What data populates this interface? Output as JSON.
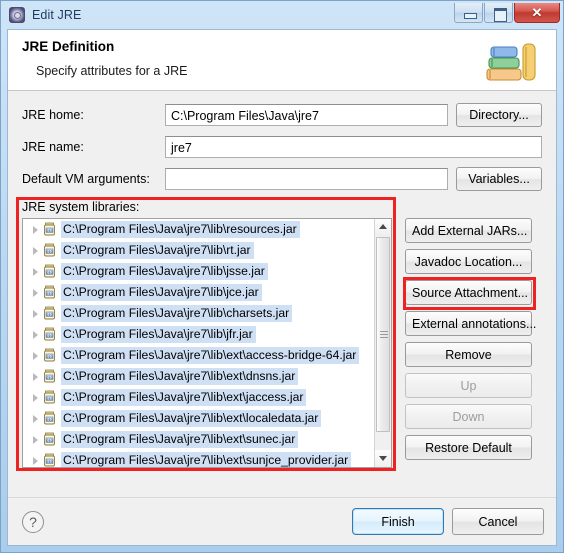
{
  "window": {
    "title": "Edit JRE",
    "icon": "jre-gear-icon",
    "minimize_label": "Minimize",
    "maximize_label": "Maximize",
    "close_label": "✕"
  },
  "header": {
    "title": "JRE Definition",
    "subtitle": "Specify attributes for a JRE",
    "icon": "books-icon"
  },
  "form": {
    "jre_home": {
      "label": "JRE home:",
      "value": "C:\\Program Files\\Java\\jre7",
      "button": "Directory..."
    },
    "jre_name": {
      "label": "JRE name:",
      "value": "jre7"
    },
    "vm_args": {
      "label": "Default VM arguments:",
      "value": "",
      "button": "Variables..."
    }
  },
  "libraries": {
    "label": "JRE system libraries:",
    "items": [
      "C:\\Program Files\\Java\\jre7\\lib\\resources.jar",
      "C:\\Program Files\\Java\\jre7\\lib\\rt.jar",
      "C:\\Program Files\\Java\\jre7\\lib\\jsse.jar",
      "C:\\Program Files\\Java\\jre7\\lib\\jce.jar",
      "C:\\Program Files\\Java\\jre7\\lib\\charsets.jar",
      "C:\\Program Files\\Java\\jre7\\lib\\jfr.jar",
      "C:\\Program Files\\Java\\jre7\\lib\\ext\\access-bridge-64.jar",
      "C:\\Program Files\\Java\\jre7\\lib\\ext\\dnsns.jar",
      "C:\\Program Files\\Java\\jre7\\lib\\ext\\jaccess.jar",
      "C:\\Program Files\\Java\\jre7\\lib\\ext\\localedata.jar",
      "C:\\Program Files\\Java\\jre7\\lib\\ext\\sunec.jar",
      "C:\\Program Files\\Java\\jre7\\lib\\ext\\sunjce_provider.jar"
    ],
    "buttons": [
      {
        "label": "Add External JARs...",
        "enabled": true
      },
      {
        "label": "Javadoc Location...",
        "enabled": true
      },
      {
        "label": "Source Attachment...",
        "enabled": true
      },
      {
        "label": "External annotations...",
        "enabled": true
      },
      {
        "label": "Remove",
        "enabled": true
      },
      {
        "label": "Up",
        "enabled": false
      },
      {
        "label": "Down",
        "enabled": false
      },
      {
        "label": "Restore Default",
        "enabled": true
      }
    ]
  },
  "footer": {
    "help": "?",
    "finish": "Finish",
    "cancel": "Cancel"
  },
  "annotations": {
    "highlight_color": "#ee2222",
    "regions": [
      "jre-system-libraries-section",
      "source-attachment-button"
    ]
  }
}
